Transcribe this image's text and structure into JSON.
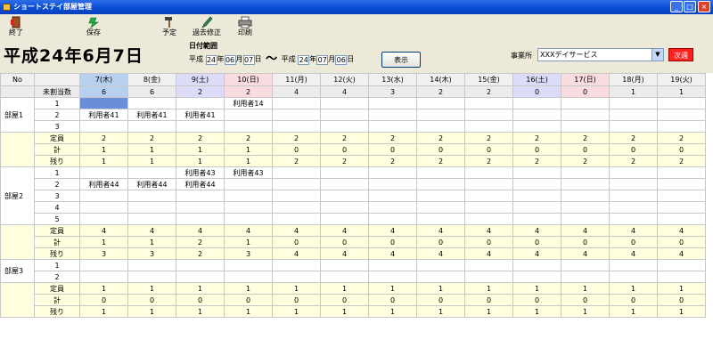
{
  "window": {
    "title": "ショートステイ部屋管理"
  },
  "toolbar": {
    "exit_label": "終了",
    "save_label": "保存",
    "schedule_label": "予定",
    "past_edit_label": "過去修正",
    "print_label": "印刷"
  },
  "header": {
    "current_date": "平成24年6月7日",
    "range_title": "日付範囲",
    "range_from_era": "平成",
    "range_from_year": "24",
    "range_from_month": "06",
    "range_from_day": "07",
    "range_to_era": "平成",
    "range_to_year": "24",
    "range_to_month": "07",
    "range_to_day": "06",
    "year_unit": "年",
    "month_unit": "月",
    "day_unit": "日",
    "tilde": "～",
    "show_button": "表示",
    "office_label": "事業所",
    "office_value": "XXXデイサービス",
    "next_button": "次週"
  },
  "grid": {
    "no_label": "No",
    "days": [
      "7(木)",
      "8(金)",
      "9(土)",
      "10(日)",
      "11(月)",
      "12(火)",
      "13(水)",
      "14(木)",
      "15(金)",
      "16(土)",
      "17(日)",
      "18(月)",
      "19(火)"
    ],
    "day_types": [
      "thu",
      "",
      "sat",
      "sun",
      "",
      "",
      "",
      "",
      "",
      "sat",
      "sun",
      "",
      ""
    ],
    "unassigned_label": "未割当数",
    "unassigned_counts": [
      "6",
      "6",
      "2",
      "2",
      "4",
      "4",
      "3",
      "2",
      "2",
      "0",
      "0",
      "1",
      "1"
    ],
    "sum_labels": {
      "capacity": "定員",
      "total": "計",
      "remaining": "残り"
    },
    "rooms": [
      {
        "name": "部屋1",
        "beds": [
          {
            "no": "1",
            "cells": [
              "",
              "",
              "",
              "利用者14",
              "",
              "",
              "",
              "",
              "",
              "",
              "",
              "",
              ""
            ]
          },
          {
            "no": "2",
            "cells": [
              "利用者41",
              "利用者41",
              "利用者41",
              "",
              "",
              "",
              "",
              "",
              "",
              "",
              "",
              "",
              ""
            ]
          },
          {
            "no": "3",
            "cells": [
              "",
              "",
              "",
              "",
              "",
              "",
              "",
              "",
              "",
              "",
              "",
              "",
              ""
            ]
          }
        ],
        "capacity": [
          "2",
          "2",
          "2",
          "2",
          "2",
          "2",
          "2",
          "2",
          "2",
          "2",
          "2",
          "2",
          "2"
        ],
        "total": [
          "1",
          "1",
          "1",
          "1",
          "0",
          "0",
          "0",
          "0",
          "0",
          "0",
          "0",
          "0",
          "0"
        ],
        "remaining": [
          "1",
          "1",
          "1",
          "1",
          "2",
          "2",
          "2",
          "2",
          "2",
          "2",
          "2",
          "2",
          "2"
        ]
      },
      {
        "name": "部屋2",
        "beds": [
          {
            "no": "1",
            "cells": [
              "",
              "",
              "利用者43",
              "利用者43",
              "",
              "",
              "",
              "",
              "",
              "",
              "",
              "",
              ""
            ]
          },
          {
            "no": "2",
            "cells": [
              "利用者44",
              "利用者44",
              "利用者44",
              "",
              "",
              "",
              "",
              "",
              "",
              "",
              "",
              "",
              ""
            ]
          },
          {
            "no": "3",
            "cells": [
              "",
              "",
              "",
              "",
              "",
              "",
              "",
              "",
              "",
              "",
              "",
              "",
              ""
            ]
          },
          {
            "no": "4",
            "cells": [
              "",
              "",
              "",
              "",
              "",
              "",
              "",
              "",
              "",
              "",
              "",
              "",
              ""
            ]
          },
          {
            "no": "5",
            "cells": [
              "",
              "",
              "",
              "",
              "",
              "",
              "",
              "",
              "",
              "",
              "",
              "",
              ""
            ]
          }
        ],
        "capacity": [
          "4",
          "4",
          "4",
          "4",
          "4",
          "4",
          "4",
          "4",
          "4",
          "4",
          "4",
          "4",
          "4"
        ],
        "total": [
          "1",
          "1",
          "2",
          "1",
          "0",
          "0",
          "0",
          "0",
          "0",
          "0",
          "0",
          "0",
          "0"
        ],
        "remaining": [
          "3",
          "3",
          "2",
          "3",
          "4",
          "4",
          "4",
          "4",
          "4",
          "4",
          "4",
          "4",
          "4"
        ]
      },
      {
        "name": "部屋3",
        "beds": [
          {
            "no": "1",
            "cells": [
              "",
              "",
              "",
              "",
              "",
              "",
              "",
              "",
              "",
              "",
              "",
              "",
              ""
            ]
          },
          {
            "no": "2",
            "cells": [
              "",
              "",
              "",
              "",
              "",
              "",
              "",
              "",
              "",
              "",
              "",
              "",
              ""
            ]
          }
        ],
        "capacity": [
          "1",
          "1",
          "1",
          "1",
          "1",
          "1",
          "1",
          "1",
          "1",
          "1",
          "1",
          "1",
          "1"
        ],
        "total": [
          "0",
          "0",
          "0",
          "0",
          "0",
          "0",
          "0",
          "0",
          "0",
          "0",
          "0",
          "0",
          "0"
        ],
        "remaining": [
          "1",
          "1",
          "1",
          "1",
          "1",
          "1",
          "1",
          "1",
          "1",
          "1",
          "1",
          "1",
          "1"
        ]
      }
    ]
  }
}
